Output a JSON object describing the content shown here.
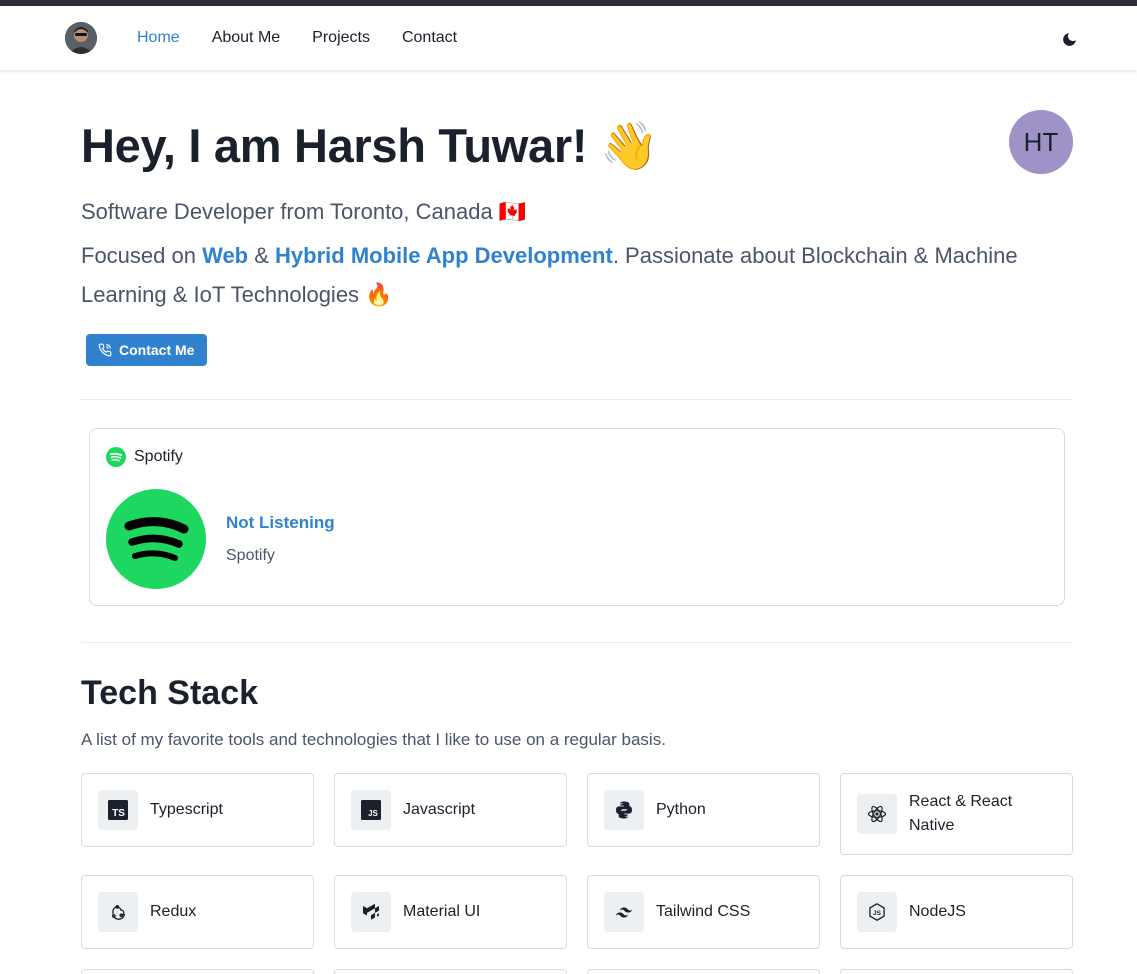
{
  "nav": {
    "links": [
      {
        "label": "Home",
        "active": true
      },
      {
        "label": "About Me",
        "active": false
      },
      {
        "label": "Projects",
        "active": false
      },
      {
        "label": "Contact",
        "active": false
      }
    ],
    "theme_toggle_icon": "moon-icon"
  },
  "hero": {
    "title": "Hey, I am Harsh Tuwar! 👋",
    "avatar_initials": "HT",
    "subtitle": "Software Developer from Toronto, Canada 🇨🇦",
    "desc_prefix": "Focused on ",
    "desc_web": "Web",
    "desc_amp": " & ",
    "desc_hybrid": "Hybrid Mobile App Development",
    "desc_suffix": ". Passionate about Blockchain & Machine Learning & IoT Technologies 🔥",
    "contact_button": "Contact Me"
  },
  "spotify": {
    "header": "Spotify",
    "status": "Not Listening",
    "subtitle": "Spotify"
  },
  "tech_stack": {
    "title": "Tech Stack",
    "description": "A list of my favorite tools and technologies that I like to use on a regular basis.",
    "items": [
      {
        "label": "Typescript",
        "icon": "typescript-icon"
      },
      {
        "label": "Javascript",
        "icon": "javascript-icon"
      },
      {
        "label": "Python",
        "icon": "python-icon"
      },
      {
        "label": "React & React Native",
        "icon": "react-icon"
      },
      {
        "label": "Redux",
        "icon": "redux-icon"
      },
      {
        "label": "Material UI",
        "icon": "material-ui-icon"
      },
      {
        "label": "Tailwind CSS",
        "icon": "tailwind-icon"
      },
      {
        "label": "NodeJS",
        "icon": "nodejs-icon"
      }
    ]
  },
  "colors": {
    "accent": "#3182ce",
    "spotify_green": "#1ed760",
    "avatar_bg": "#9f92c6"
  }
}
